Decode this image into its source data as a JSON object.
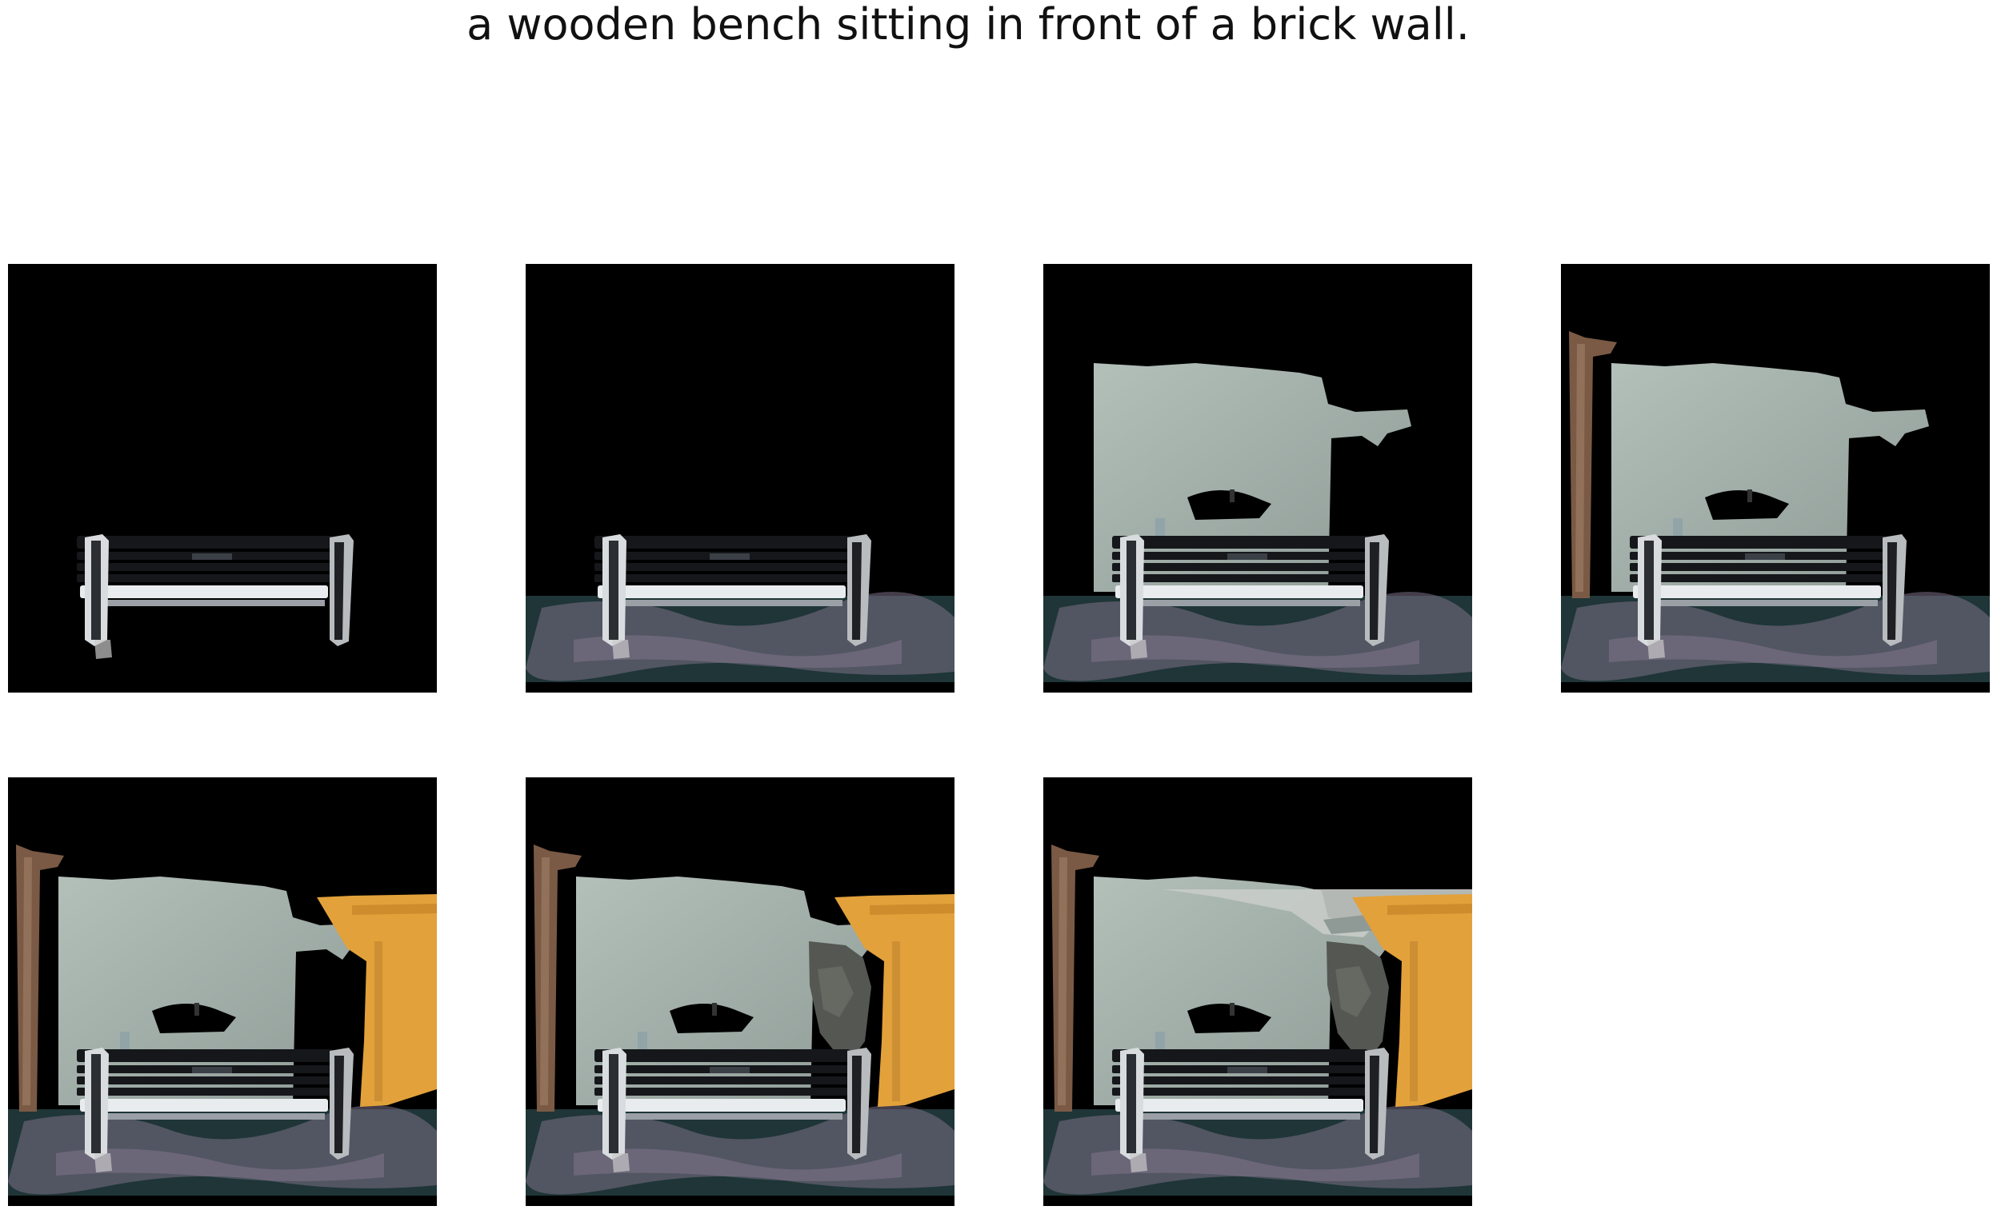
{
  "caption": "a wooden bench sitting in front of a brick wall.",
  "colors": {
    "background": "#000000",
    "ground": "#1f3537",
    "ground_gravel": "#7c6f86",
    "wall": "#a6b3ad",
    "post": "#7a5a45",
    "door": "#e2a13a",
    "bench": "#15171b",
    "bench_highlight": "#e9ecef",
    "rubble": "#545752",
    "ceiling": "#c8ccc9"
  },
  "panels": [
    {
      "step": 1,
      "layers": [
        "bench"
      ]
    },
    {
      "step": 2,
      "layers": [
        "ground",
        "bench"
      ]
    },
    {
      "step": 3,
      "layers": [
        "ground",
        "wall",
        "bench"
      ]
    },
    {
      "step": 4,
      "layers": [
        "ground",
        "post",
        "wall",
        "bench"
      ]
    },
    {
      "step": 5,
      "layers": [
        "ground",
        "post",
        "wall",
        "door",
        "bench"
      ]
    },
    {
      "step": 6,
      "layers": [
        "ground",
        "post",
        "wall",
        "door",
        "rubble",
        "bench"
      ]
    },
    {
      "step": 7,
      "layers": [
        "ground",
        "post",
        "wall",
        "ceiling",
        "door",
        "rubble",
        "bench"
      ]
    }
  ]
}
